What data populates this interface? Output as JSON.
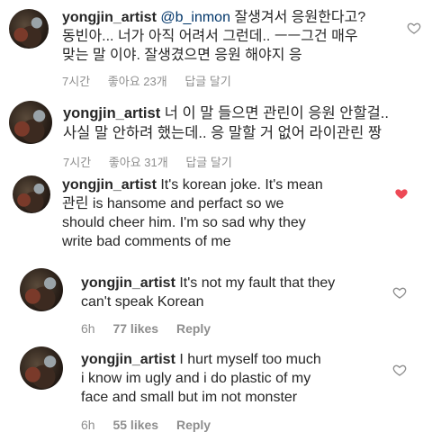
{
  "comments": [
    {
      "username": "yongjin_artist",
      "mention": "@b_inmon",
      "lines": [
        "잘생겨서 응원한다고?",
        "동빈아... 너가 아직 어려서 그런데.. ㅡㅡ그건 매우",
        "맞는 말 이야. 잘생겼으면 응원 해야지 응"
      ],
      "time": "7시간",
      "likes": "좋아요 23개",
      "reply": "답글 달기",
      "liked": false
    },
    {
      "username": "yongjin_artist",
      "lines": [
        "너 이 말 들으면 관린이 응원 안할걸..",
        "사실 말 안하려 했는데.. 응 말할 거 없어 라이관린 짱"
      ],
      "time": "7시간",
      "likes": "좋아요 31개",
      "reply": "답글 달기",
      "liked": false
    },
    {
      "username": "yongjin_artist",
      "lines": [
        "It's korean joke. It's mean",
        "관린 is hansome and perfact so we",
        "should cheer him. I'm so sad why they",
        "write bad comments of me"
      ],
      "time": "",
      "likes": "",
      "reply": "",
      "liked": true
    },
    {
      "username": "yongjin_artist",
      "lines": [
        "It's not my fault that they",
        "can't speak Korean"
      ],
      "time": "6h",
      "likes": "77 likes",
      "reply": "Reply",
      "liked": false
    },
    {
      "username": "yongjin_artist",
      "lines": [
        "I hurt myself too much",
        "i know im ugly and i do plastic of my",
        "face and small but im not monster"
      ],
      "time": "6h",
      "likes": "55 likes",
      "reply": "Reply",
      "liked": false
    }
  ],
  "colors": {
    "heart_liked": "#ed4956",
    "heart_outline": "#8e8e8e",
    "meta": "#8e8e8e"
  }
}
